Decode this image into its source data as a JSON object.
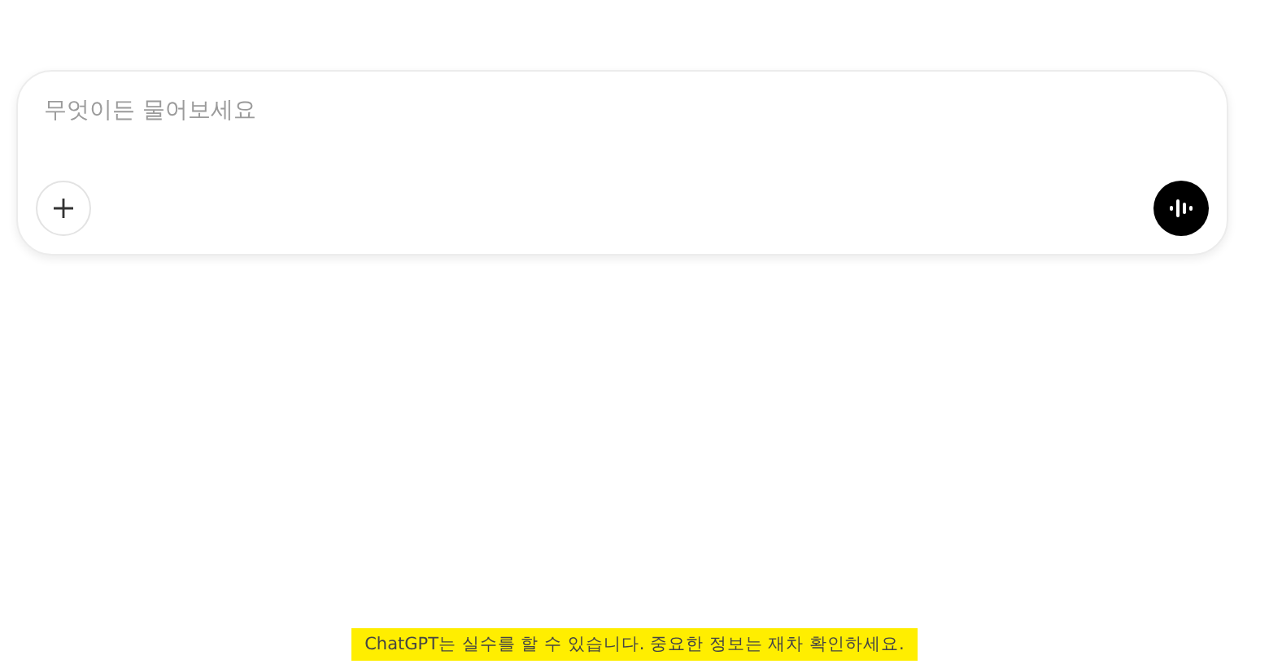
{
  "composer": {
    "placeholder": "무엇이든 물어보세요"
  },
  "disclaimer": {
    "text": "ChatGPT는 실수를 할 수 있습니다. 중요한 정보는 재차 확인하세요.",
    "highlighted": true
  }
}
